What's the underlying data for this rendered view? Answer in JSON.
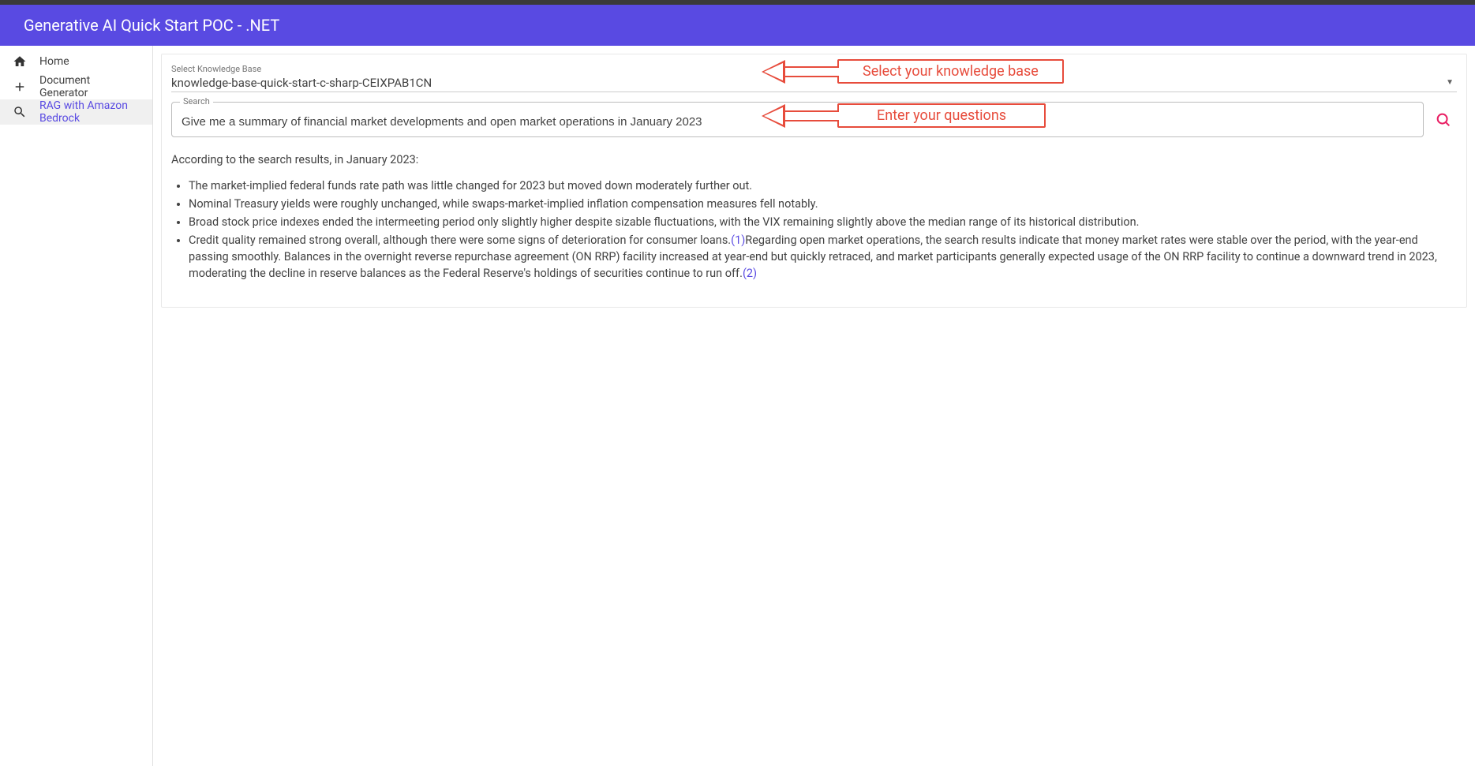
{
  "header": {
    "title": "Generative AI Quick Start POC - .NET"
  },
  "sidebar": {
    "items": [
      {
        "icon": "home",
        "label": "Home"
      },
      {
        "icon": "plus",
        "label": "Document Generator"
      },
      {
        "icon": "search",
        "label": "RAG with Amazon Bedrock",
        "active": true
      }
    ]
  },
  "kb": {
    "label": "Select Knowledge Base",
    "value": "knowledge-base-quick-start-c-sharp-CEIXPAB1CN"
  },
  "search": {
    "label": "Search",
    "value": "Give me a summary of financial market developments and open market operations in January 2023"
  },
  "annotations": {
    "kb": "Select your  knowledge base",
    "search": "Enter your questions"
  },
  "results": {
    "intro": "According to the search results, in January 2023:",
    "bullets": [
      "The market-implied federal funds rate path was little changed for 2023 but moved down moderately further out.",
      "Nominal Treasury yields were roughly unchanged, while swaps-market-implied inflation compensation measures fell notably.",
      "Broad stock price indexes ended the intermeeting period only slightly higher despite sizable fluctuations, with the VIX remaining slightly above the median range of its historical distribution."
    ],
    "bullet4_part1": "Credit quality remained strong overall, although there were some signs of deterioration for consumer loans.",
    "bullet4_cite1": "(1)",
    "bullet4_part2": "Regarding open market operations, the search results indicate that money market rates were stable over the period, with the year-end passing smoothly. Balances in the overnight reverse repurchase agreement (ON RRP) facility increased at year-end but quickly retraced, and market participants generally expected usage of the ON RRP facility to continue a downward trend in 2023, moderating the decline in reserve balances as the Federal Reserve's holdings of securities continue to run off.",
    "bullet4_cite2": "(2)"
  }
}
